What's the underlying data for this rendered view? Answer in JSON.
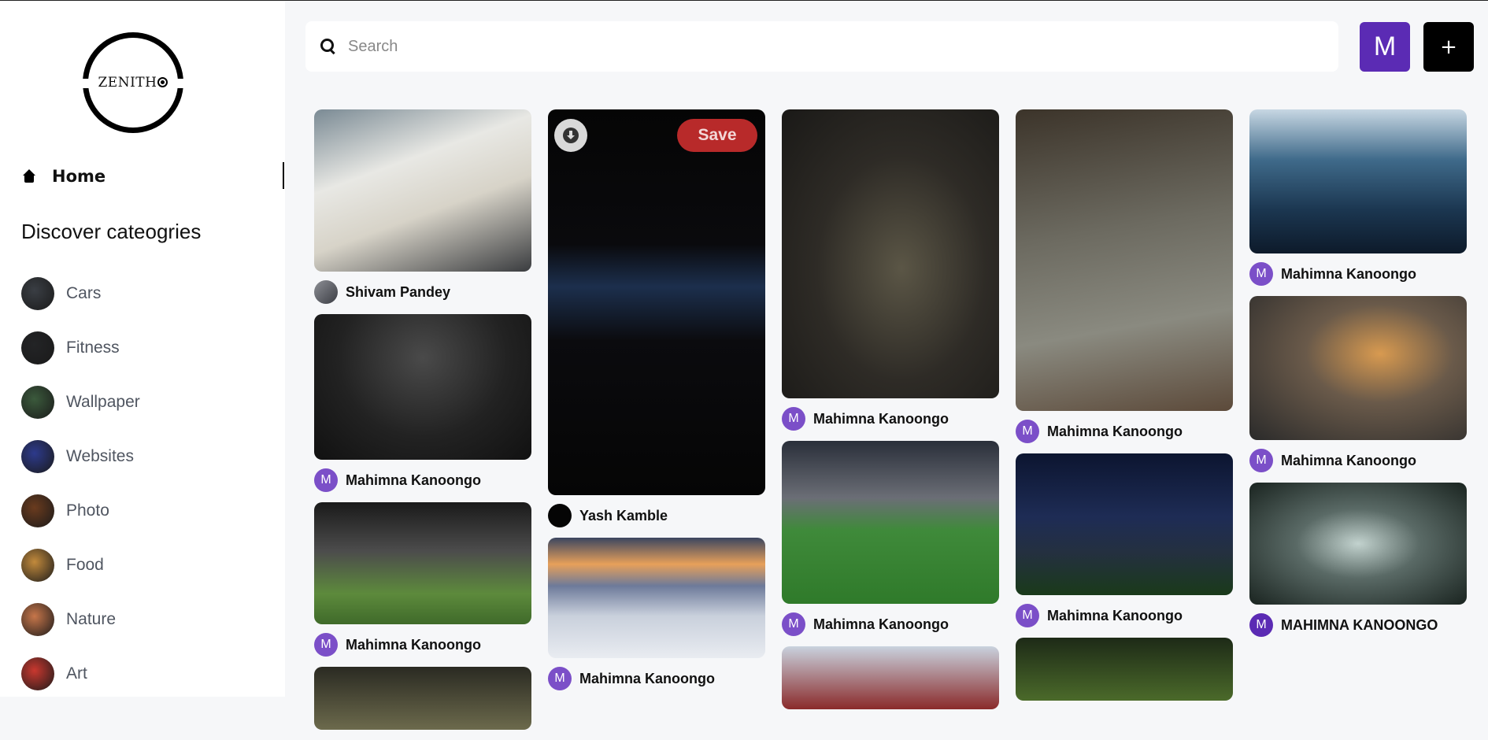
{
  "brand": {
    "logo_text": "ZENITH"
  },
  "nav": {
    "home_label": "Home"
  },
  "discover": {
    "title": "Discover cateogries",
    "items": [
      {
        "label": "Cars",
        "icon": "cars-thumb-icon",
        "color": "#3a3e44"
      },
      {
        "label": "Fitness",
        "icon": "fitness-thumb-icon",
        "color": "#232426"
      },
      {
        "label": "Wallpaper",
        "icon": "wallpaper-thumb-icon",
        "color": "#3b5a3c"
      },
      {
        "label": "Websites",
        "icon": "websites-thumb-icon",
        "color": "#2d3a8c"
      },
      {
        "label": "Photo",
        "icon": "photo-thumb-icon",
        "color": "#6a3b1e"
      },
      {
        "label": "Food",
        "icon": "food-thumb-icon",
        "color": "#c28a3c"
      },
      {
        "label": "Nature",
        "icon": "nature-thumb-icon",
        "color": "#c7764a"
      },
      {
        "label": "Art",
        "icon": "art-thumb-icon",
        "color": "#c9382f"
      }
    ]
  },
  "search": {
    "placeholder": "Search"
  },
  "header": {
    "avatar_letter": "M",
    "add_label": "+"
  },
  "pins": {
    "save_label": "Save",
    "columns": [
      [
        {
          "author": "Shivam Pandey",
          "avatar": "",
          "avatar_style": "photo",
          "bg": "linear-gradient(160deg,#7a8a94 0%,#e8e8e4 35%,#d7d3c8 60%,#3a3c3f 100%)"
        },
        {
          "author": "Mahimna Kanoongo",
          "avatar": "M",
          "avatar_style": "",
          "bg": "radial-gradient(ellipse at 50% 30%,#4a4a4a 0%,#222 55%,#111 100%)"
        },
        {
          "author": "Mahimna Kanoongo",
          "avatar": "M",
          "avatar_style": "",
          "bg": "linear-gradient(180deg,#1a1a1a 0%,#4c4c4c 40%,#5d8a3c 75%,#3f6a2a 100%)"
        },
        {
          "author": "",
          "avatar": "",
          "avatar_style": "",
          "bg": "linear-gradient(180deg,#2a2a22 0%,#6c6a4c 100%)"
        }
      ],
      [
        {
          "author": "Yash Kamble",
          "avatar": "",
          "avatar_style": "dark",
          "bg": "linear-gradient(180deg,#050505 0%,#0a0a0d 35%,#1c2f4d 46%,#0b0b0e 60%,#050505 100%)",
          "hover": true
        },
        {
          "author": "Mahimna Kanoongo",
          "avatar": "M",
          "avatar_style": "",
          "bg": "linear-gradient(180deg,#3b4660 0%,#e7a05a 22%,#6d7a9a 40%,#c9d0dc 65%,#e9ecf1 100%)"
        }
      ],
      [
        {
          "author": "Mahimna Kanoongo",
          "avatar": "M",
          "avatar_style": "",
          "bg": "radial-gradient(ellipse at 55% 55%,#5b5646 0%,#2e2b26 50%,#1a1917 100%)"
        },
        {
          "author": "Mahimna Kanoongo",
          "avatar": "M",
          "avatar_style": "",
          "bg": "linear-gradient(180deg,#2a2f3a 0%,#6b6e76 35%,#3f8a3a 55%,#2f7a2a 100%)"
        },
        {
          "author": "",
          "avatar": "",
          "avatar_style": "",
          "bg": "linear-gradient(180deg,#c9d2de 0%,#8a2a2a 100%)"
        }
      ],
      [
        {
          "author": "Mahimna Kanoongo",
          "avatar": "M",
          "avatar_style": "",
          "bg": "linear-gradient(170deg,#3c342a 0%,#6c6a60 40%,#8a8a80 70%,#5c4a3a 100%)"
        },
        {
          "author": "Mahimna Kanoongo",
          "avatar": "M",
          "avatar_style": "",
          "bg": "linear-gradient(180deg,#0c1530 0%,#1e2c55 45%,#243040 70%,#1a3a1a 100%)"
        },
        {
          "author": "",
          "avatar": "",
          "avatar_style": "",
          "bg": "linear-gradient(180deg,#1d2a17 0%,#4b6a2a 100%)"
        }
      ],
      [
        {
          "author": "Mahimna Kanoongo",
          "avatar": "M",
          "avatar_style": "",
          "bg": "linear-gradient(180deg,#c7d7e3 0%,#3f6a8a 35%,#1b3650 70%,#0d1a2a 100%)"
        },
        {
          "author": "Mahimna Kanoongo",
          "avatar": "M",
          "avatar_style": "",
          "bg": "radial-gradient(ellipse at 60% 40%,#d89a50 0%,#6a5a4a 40%,#2a2a2a 100%)"
        },
        {
          "author": "MAHIMNA KANOONGO",
          "avatar": "M",
          "avatar_style": "deep",
          "bg": "radial-gradient(ellipse at 50% 50%,#c2d2ce 0%,#5a6a66 40%,#1a2420 100%)"
        }
      ]
    ]
  }
}
